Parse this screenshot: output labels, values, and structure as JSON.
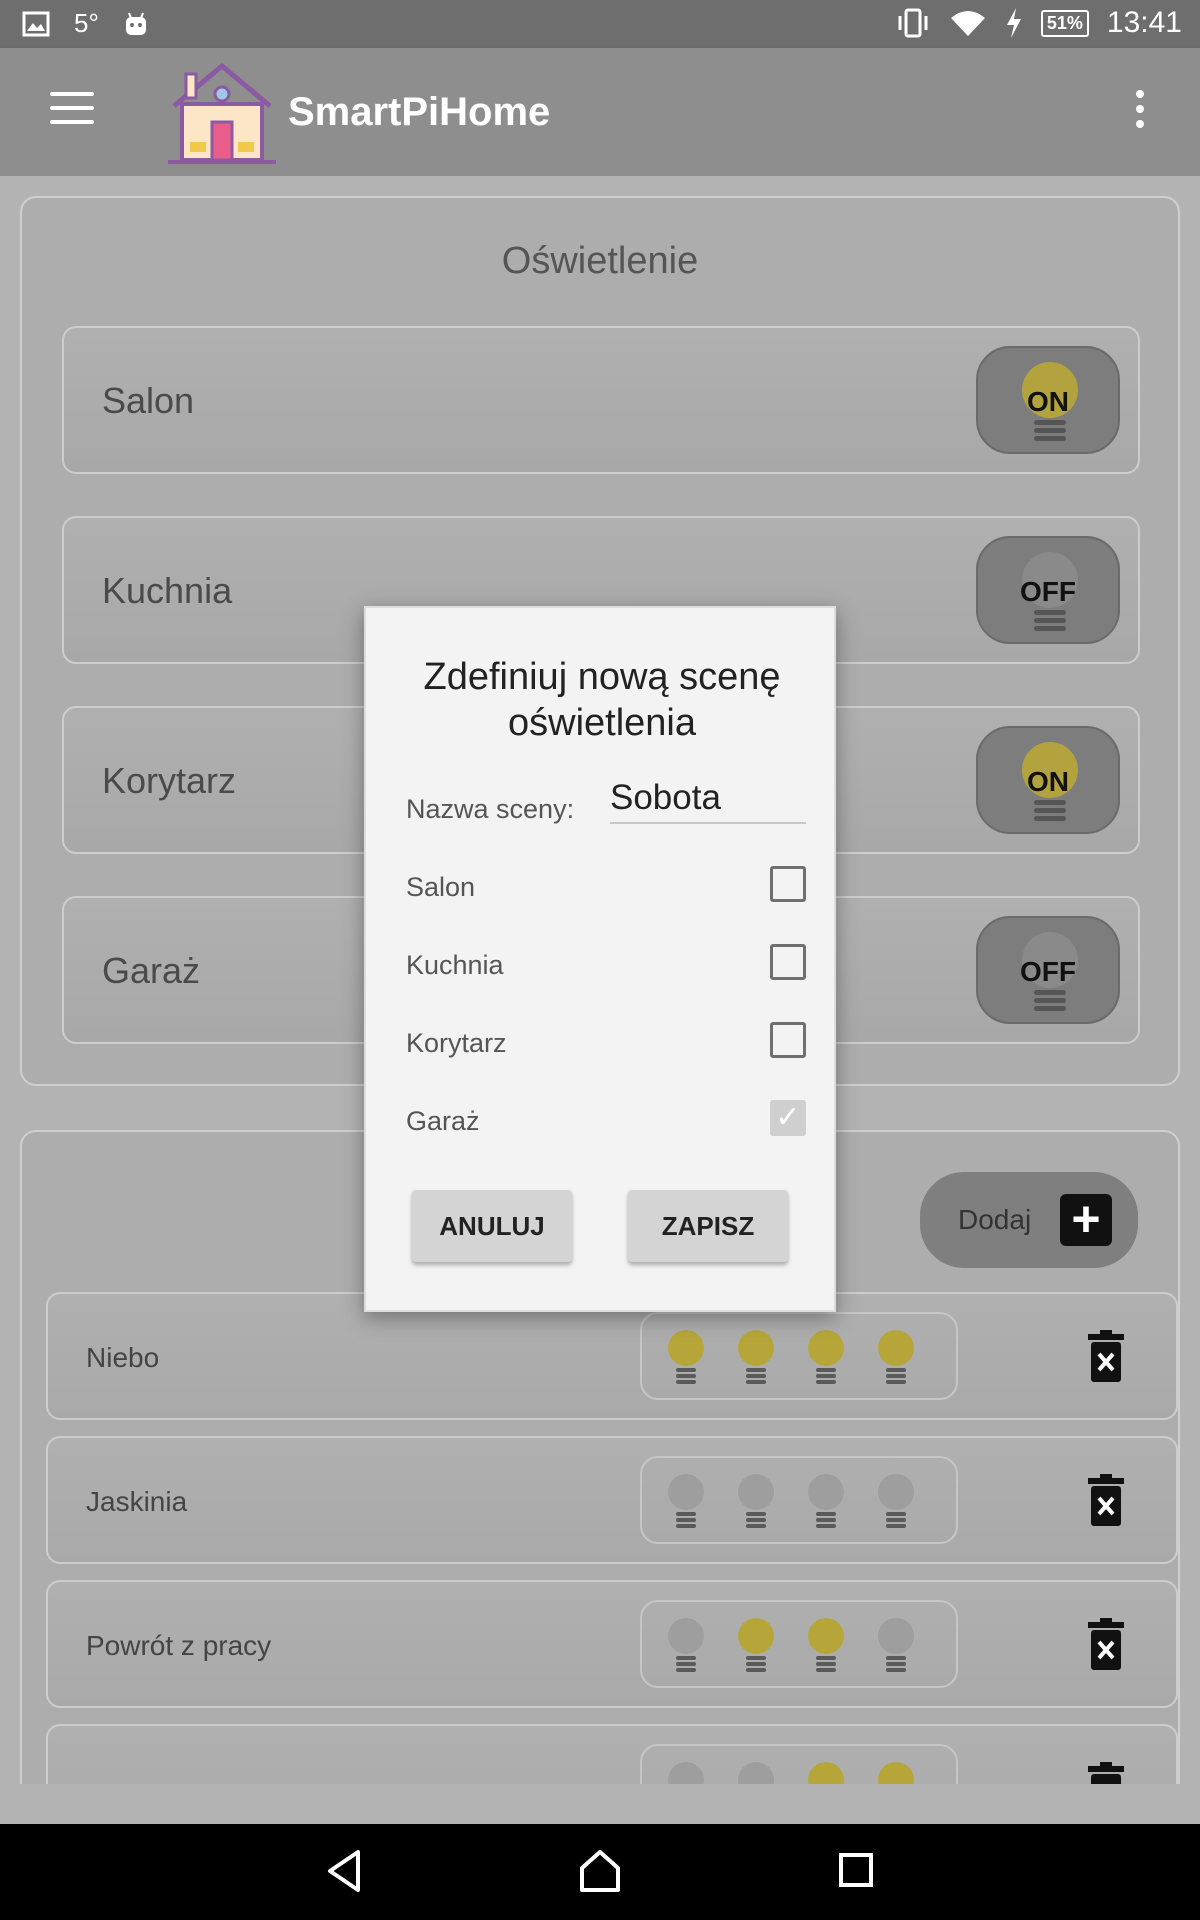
{
  "status_bar": {
    "temperature": "5°",
    "battery": "51%",
    "time": "13:41",
    "icons": [
      "image-icon",
      "android-icon",
      "vibrate-icon",
      "wifi-icon",
      "charging-icon",
      "battery-icon"
    ]
  },
  "app_bar": {
    "title": "SmartPiHome",
    "icons": [
      "menu-icon",
      "house-logo",
      "more-vert-icon"
    ]
  },
  "lighting": {
    "title": "Oświetlenie",
    "rooms": [
      {
        "name": "Salon",
        "state": "ON"
      },
      {
        "name": "Kuchnia",
        "state": "OFF"
      },
      {
        "name": "Korytarz",
        "state": "ON"
      },
      {
        "name": "Garaż",
        "state": "OFF"
      }
    ]
  },
  "scenes": {
    "add_label": "Dodaj",
    "items": [
      {
        "name": "Niebo",
        "bulbs": [
          true,
          true,
          true,
          true
        ]
      },
      {
        "name": "Jaskinia",
        "bulbs": [
          false,
          false,
          false,
          false
        ]
      },
      {
        "name": "Powrót z pracy",
        "bulbs": [
          false,
          true,
          true,
          false
        ]
      },
      {
        "name": "",
        "bulbs": [
          false,
          false,
          true,
          true
        ]
      }
    ]
  },
  "dialog": {
    "title": "Zdefiniuj nową scenę oświetlenia",
    "name_label": "Nazwa sceny:",
    "name_value": "Sobota",
    "checkboxes": [
      {
        "label": "Salon",
        "checked": false
      },
      {
        "label": "Kuchnia",
        "checked": false
      },
      {
        "label": "Korytarz",
        "checked": false
      },
      {
        "label": "Garaż",
        "checked": true,
        "disabled": true
      }
    ],
    "cancel_label": "ANULUJ",
    "save_label": "ZAPISZ"
  },
  "colors": {
    "bulb_on": "#f2d83a",
    "bulb_off": "#9e9e9e",
    "accent_logo": "#e85d8a"
  }
}
